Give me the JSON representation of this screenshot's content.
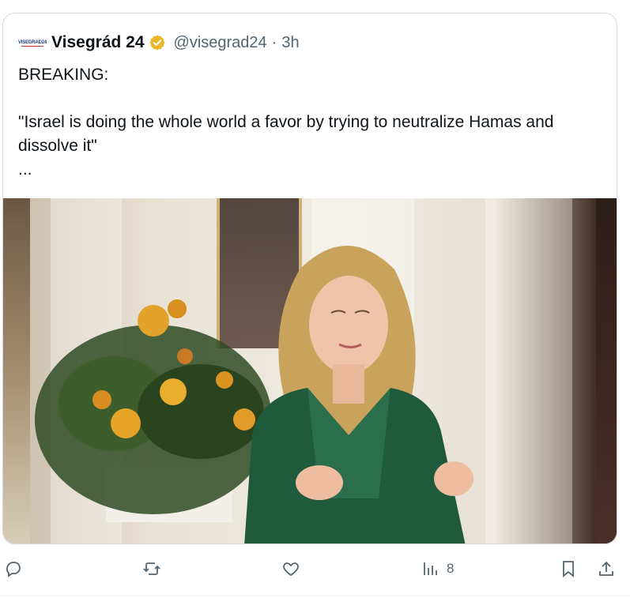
{
  "quoted_tweet": {
    "avatar_text": "VISEGRAD24",
    "display_name": "Visegrád 24",
    "handle": "@visegrad24",
    "separator": "·",
    "time": "3h",
    "text_line_1": "BREAKING:",
    "text_line_2": "\"Israel is doing the whole world a favor by trying to neutralize Hamas and dissolve it\"",
    "text_line_3": "...",
    "media": {
      "description_icon": "photo"
    }
  },
  "actions": {
    "reply_icon": "reply-icon",
    "retweet_icon": "retweet-icon",
    "like_icon": "like-icon",
    "views_icon": "views-icon",
    "views_count": "8",
    "bookmark_icon": "bookmark-icon",
    "share_icon": "share-icon"
  },
  "colors": {
    "verified_gold": "#e8b829",
    "muted": "#536471",
    "border": "#cfd9de"
  }
}
